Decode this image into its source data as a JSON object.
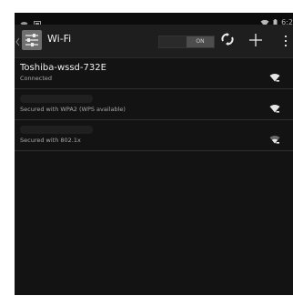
{
  "statusbar": {
    "time": "6:2"
  },
  "actionbar": {
    "title": "Wi-Fi",
    "toggle_label": "ON"
  },
  "networks": [
    {
      "name": "Toshiba-wssd-732E",
      "status": "Connected",
      "signal_icon": "wifi-signal-full-icon"
    },
    {
      "name": "",
      "status": "Secured with WPA2 (WPS available)",
      "signal_icon": "wifi-signal-full-icon"
    },
    {
      "name": "",
      "status": "Secured with 802.1x",
      "signal_icon": "wifi-signal-weak-icon"
    }
  ],
  "colors": {
    "background": "#131313",
    "actionbar": "#1e1e1e",
    "text": "#f0f0f0",
    "subtext": "#a8a8a8"
  }
}
